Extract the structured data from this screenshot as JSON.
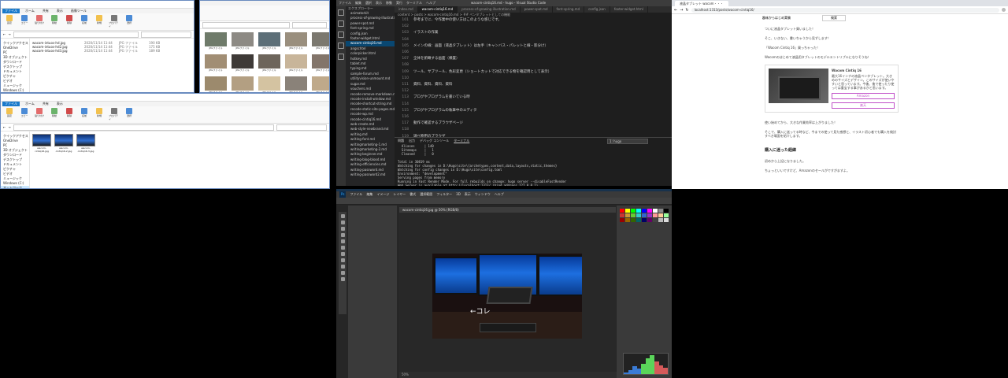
{
  "explorer_top": {
    "ribbon_tabs": [
      "ファイル",
      "ホーム",
      "共有",
      "表示",
      "画像ツール"
    ],
    "ribbon_labels": [
      "固定",
      "コピー",
      "貼り付け",
      "移動",
      "削除",
      "名前",
      "新規",
      "プロパティ",
      "選択"
    ],
    "nav": [
      "クイックアクセス",
      "OneDrive",
      "PC",
      "3D オブジェクト",
      "ダウンロード",
      "デスクトップ",
      "ドキュメント",
      "ピクチャ",
      "ビデオ",
      "ミュージック",
      "Windows (C:)",
      "ネットワーク"
    ],
    "files": [
      {
        "name": "wacom-intuos-hd.jpg",
        "date": "2020/11/14 11:44",
        "type": "JPG ファイル",
        "size": "190 KB"
      },
      {
        "name": "wacom-intuos-hd2.jpg",
        "date": "2020/11/14 11:44",
        "type": "JPG ファイル",
        "size": "175 KB"
      },
      {
        "name": "wacom-intuos-hd3.jpg",
        "date": "2020/11/14 11:44",
        "type": "JPG ファイル",
        "size": "189 KB"
      }
    ]
  },
  "explorer_bottom": {
    "ribbon_tabs": [
      "ファイル",
      "ホーム",
      "共有",
      "表示"
    ],
    "ribbon_labels": [
      "固定",
      "コピー",
      "貼り付け",
      "移動",
      "削除",
      "名前",
      "新規",
      "プロパティ",
      "選択"
    ],
    "thumbs": [
      "wacom-cintiq16.jpg",
      "wacom-cintiq16-2.jpg",
      "wacom-cintiq16-3.jpg"
    ]
  },
  "photos": {
    "labels": [
      "JPGファイル",
      "JPGファイル",
      "JPGファイル",
      "JPGファイル",
      "JPGファイル",
      "JPGファイル",
      "JPGファイル",
      "JPGファイル",
      "JPGファイル",
      "JPGファイル",
      "JPGファイル",
      "JPGファイル",
      "JPGファイル",
      "JPGファイル",
      "JPGファイル",
      "JPGファイル",
      "JPGファイル",
      "JPGファイル",
      "JPGファイル",
      "JPGファイル",
      "JPGファイル",
      "JPGファイル",
      "JPGファイル",
      "JPGファイル",
      "JPGファイル",
      "JPGファイル",
      "JPGファイル",
      "JPGファイル",
      "JPGファイル",
      "JPGファイル"
    ],
    "colors": [
      "#6f7b6a",
      "#8d8a84",
      "#5d6f78",
      "#9a8f7e",
      "#7b786f",
      "#556b5f",
      "#a18e74",
      "#3e3a37",
      "#6d655b",
      "#c8b59a",
      "#83756a",
      "#4a4f4e",
      "#9c8a6d",
      "#b39f82",
      "#d4c3a1",
      "#8a8279",
      "#bfa98a",
      "#7d6f5c",
      "#c9b38f",
      "#e2d7c2",
      "#a9957a",
      "#6b5e50",
      "#cbbfa8",
      "#b09a7d",
      "#8f8f8f",
      "#b7aa90",
      "#5a5045",
      "#d8ccb0",
      "#9e9384",
      "#7a6c5d"
    ]
  },
  "vscode": {
    "title_menu": [
      "ファイル",
      "編集",
      "選択",
      "表示",
      "移動",
      "実行",
      "ターミナル",
      "ヘルプ"
    ],
    "title_doc": "wacom-cintiq16.md - hugo - Visual Studio Code",
    "explorer_title": "エクスプローラー",
    "files": [
      "animatorkit",
      "process-of-growing-illustration",
      "power-spot.md",
      "font-spring.md",
      "config.json",
      "footer-widget.html",
      "wacom-cintiq16.md",
      "angschtel",
      "colorpicker.html",
      "hotkey.md",
      "tablet.md",
      "typing.md",
      "sample-forum.md",
      "utilityvision-unmount.md",
      "sugar.md",
      "vouchers.md",
      "recode-remove-markdown.md",
      "recode-install-window.md",
      "recode-shortcut-string.md",
      "recode-static-site-pages.md",
      "recode-wp.md",
      "recode-cintiq16.md",
      "web-create.md",
      "web-style-newbrand.md",
      "writing.md",
      "writing-font.md",
      "writingmarketing-1.md",
      "writingmarketing-2.md",
      "writing-beginner.md",
      "writing-blog-blood.md",
      "writing-efficiencies.md",
      "writing-password.md",
      "writing-password2.md"
    ],
    "selected_index": 6,
    "tabs": [
      "index.md",
      "wacom-cintiq16.md",
      "process-of-growing-illustration.md",
      "power-spot.md",
      "font-spring.md",
      "config.json",
      "footer-widget.html"
    ],
    "active_tab": 1,
    "breadcrumb": "content > posts > wacom-cintiq16.md > ## ペンタブレットとしての機能",
    "lines": [
      {
        "n": "101",
        "t": "参考までに、今作業中の使い方はこのような感じです。",
        "h": false
      },
      {
        "n": "102",
        "t": "",
        "h": false
      },
      {
        "n": "103",
        "t": "イラストの作業",
        "h": false
      },
      {
        "n": "104",
        "t": "",
        "h": false
      },
      {
        "n": "105",
        "t": "メインの線：画面（液晶タブレット）は左手（キャンバス・パレットと線・影分け）",
        "h": false
      },
      {
        "n": "106",
        "t": "",
        "h": false
      },
      {
        "n": "107",
        "t": "全体を俯瞰する画面（横置）",
        "h": false
      },
      {
        "n": "108",
        "t": "",
        "h": false
      },
      {
        "n": "109",
        "t": "ツール、サブツール、色彩変更（ショートカットで対応できる物を確認用として表示）",
        "h": false
      },
      {
        "n": "110",
        "t": "",
        "h": false
      },
      {
        "n": "111",
        "t": "資料、資料、資料、資料",
        "h": false
      },
      {
        "n": "112",
        "t": "",
        "h": false
      },
      {
        "n": "113",
        "t": "ブログやプログラムを書いている時",
        "h": false
      },
      {
        "n": "114",
        "t": "",
        "h": false
      },
      {
        "n": "115",
        "t": "ブログやプログラムの執筆中のエディタ",
        "h": false
      },
      {
        "n": "116",
        "t": "",
        "h": false
      },
      {
        "n": "117",
        "t": "動作で確認するブラウザページ",
        "h": false
      },
      {
        "n": "118",
        "t": "",
        "h": false
      },
      {
        "n": "119",
        "t": "調べ物用のブラウザ",
        "h": false
      },
      {
        "n": "120",
        "t": "",
        "h": false
      },
      {
        "n": "121",
        "t": "って感じですね。",
        "h": false
      },
      {
        "n": "122",
        "t": "",
        "h": false
      },
      {
        "n": "123",
        "t": "キムラで使うとイラストの作業効率が上がるのでイラストがすぐよ！",
        "h": false
      },
      {
        "n": "124",
        "t": "",
        "h": false
      },
      {
        "n": "125",
        "t": "### ペンタブレットとしての機能",
        "h": true
      },
      {
        "n": "126",
        "t": "",
        "h": false
      },
      {
        "n": "127",
        "t": "まず、メインどころですね。",
        "h": false
      }
    ],
    "terminal_tabs": [
      "問題",
      "出力",
      "デバッグ コンソール",
      "ターミナル"
    ],
    "terminal_select": "1: hugo",
    "terminal_text": "  Aliases     | 140\n  Sitemaps    |   1\n  Cleaned     |   0\n\nTotal in 30819 ms\nWatching for changes in D:\\Hugo\\site\\{archetypes,content,data,layouts,static,themes}\nWatching for config changes in D:\\Hugo\\site\\config.toml\nEnvironment: \"development\"\nServing pages from memory\nRunning in Fast Render Mode. For full rebuilds on change: hugo server --disableFastRender\nWeb Server is available at http://localhost:1313/ (bind address 127.0.0.1)\nPress Ctrl+C to stop"
  },
  "chrome": {
    "tab": "液晶タブレット wacom・・・",
    "url": "localhost:1313/posts/wacom-cintiq16/",
    "bar_left": "趣味からはじめ実験",
    "bar_btn": "検索",
    "paragraphs": [
      "ついに液晶タブレット買いました！",
      "そこ、いきない、書いちゃうから見ずします！",
      "「Wacom Cintiq 16」買っちゃった！",
      "Wacomのはじめて液晶用タブレットのモデルエントリプルになりそうね！"
    ],
    "card_title": "Wacom Cintiq 16",
    "card_text": "最大16インチの液晶ペンタブレット。大きめのサイズとデザイン。このサイズが使いやすいと思っています。今後、後で使ったり使っては重宝する事があるかと思います。",
    "card_btn1": "Amazon",
    "card_btn2": "楽天",
    "after_card": [
      "使い始めてから、大きな作業効率は上がりました！",
      "そこで、購入に迷ってる時など、今までの使って見た感想と、イラスト初心者でも購入を検討すべき場面を紹介します。"
    ],
    "heading": "購入に迷った経緯",
    "tail": [
      "初めから上記になりました。",
      "ちょっといいですけど、Amazonのセールがですがますよ。"
    ]
  },
  "photoshop": {
    "menu": [
      "Ps",
      "ファイル",
      "編集",
      "イメージ",
      "レイヤー",
      "書式",
      "選択範囲",
      "フィルター",
      "3D",
      "表示",
      "ウィンドウ",
      "ヘルプ"
    ],
    "doc_tab": "wacom-cintiq16.jpg @ 50% (RGB/8)",
    "image_label": "←コレ",
    "status": "50%",
    "swatches": [
      "#ff0000",
      "#ffff00",
      "#00ff00",
      "#00ffff",
      "#0000ff",
      "#ff00ff",
      "#ffffff",
      "#888888",
      "#000000",
      "#cc3333",
      "#cc9933",
      "#66cc33",
      "#33cccc",
      "#3366cc",
      "#9933cc",
      "#ff9999",
      "#ffcc99",
      "#99ff99",
      "#990000",
      "#996600",
      "#336600",
      "#006666",
      "#000066",
      "#660066",
      "#444444",
      "#bbbbbb",
      "#dddddd"
    ],
    "hist": [
      2,
      5,
      9,
      6,
      12,
      18,
      22,
      15,
      10,
      7
    ]
  }
}
